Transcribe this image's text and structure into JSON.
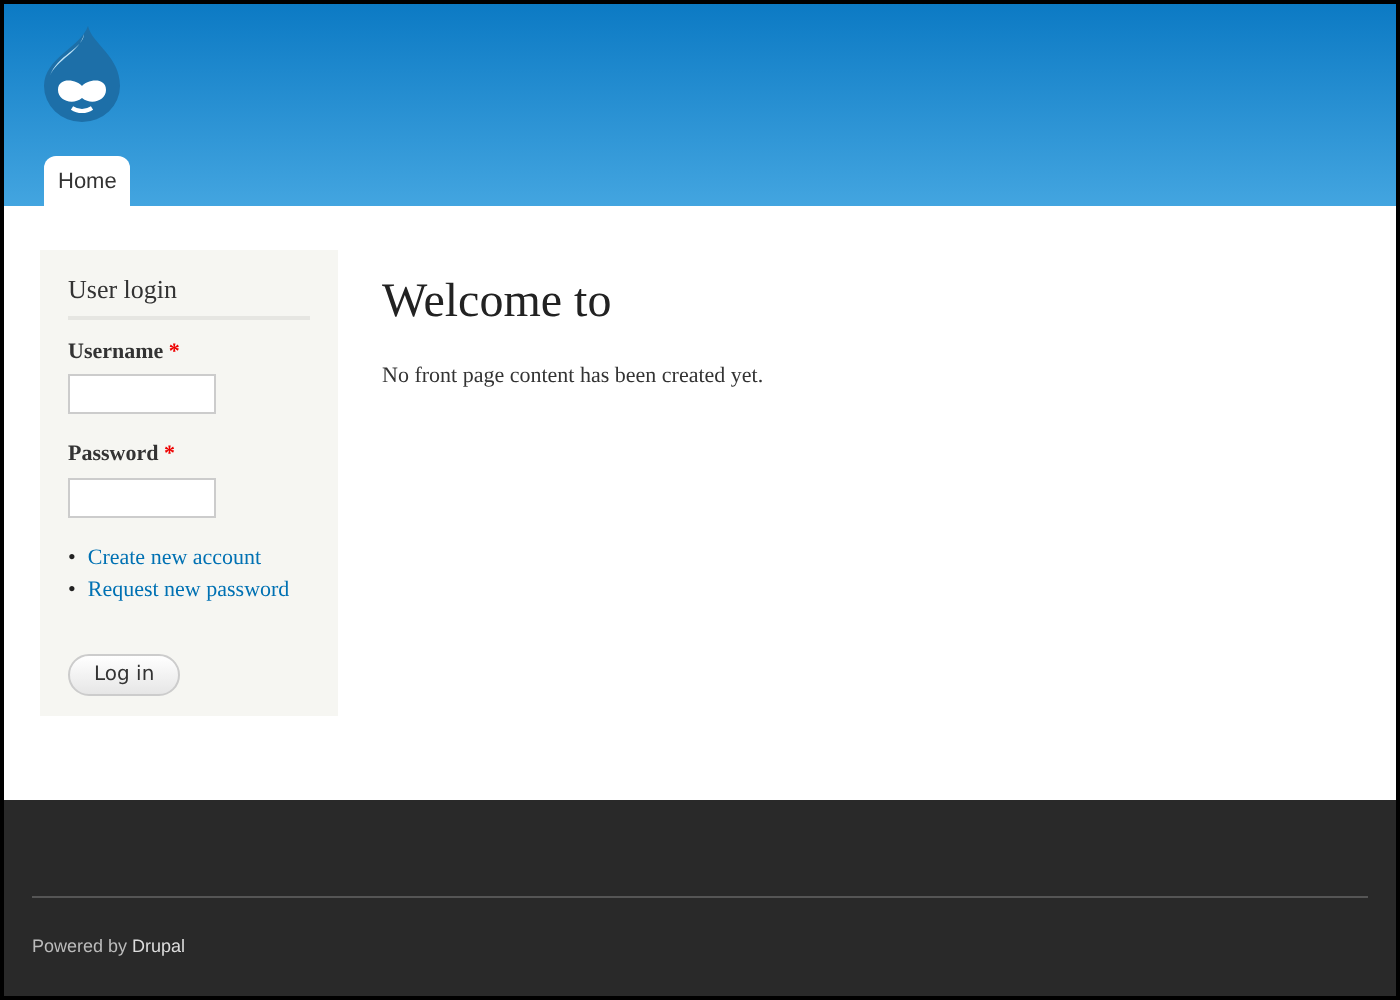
{
  "header": {
    "tabs": [
      {
        "label": "Home",
        "selected": true
      }
    ]
  },
  "sidebar": {
    "block_title": "User login",
    "fields": [
      {
        "label": "Username",
        "required_mark": "*"
      },
      {
        "label": "Password",
        "required_mark": "*"
      }
    ],
    "links": [
      {
        "bullet": "•",
        "label": "Create new account"
      },
      {
        "bullet": "•",
        "label": "Request new password"
      }
    ],
    "button": "Log in"
  },
  "content": {
    "title": "Welcome to",
    "text": "No front page content has been created yet."
  },
  "footer": {
    "prefix": "Powered by",
    "link": "Drupal"
  }
}
